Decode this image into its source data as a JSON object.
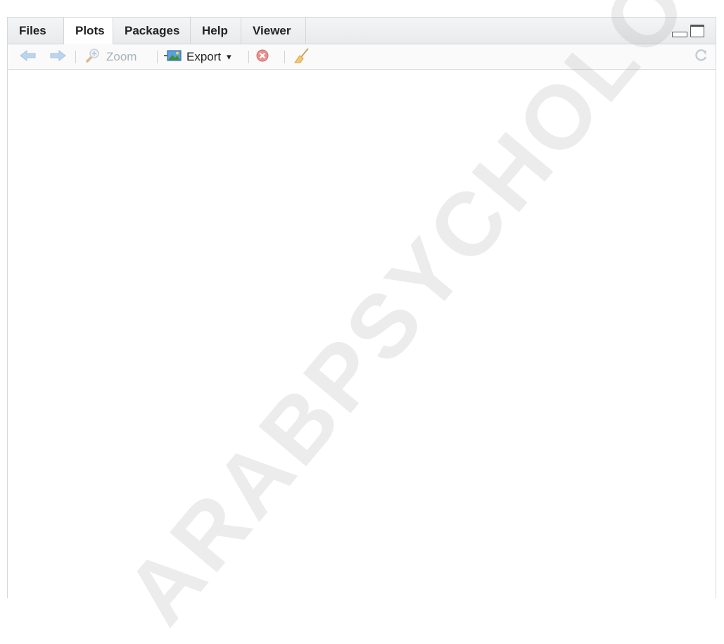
{
  "tabs": [
    {
      "label": "Files",
      "active": false
    },
    {
      "label": "Plots",
      "active": true
    },
    {
      "label": "Packages",
      "active": false
    },
    {
      "label": "Help",
      "active": false
    },
    {
      "label": "Viewer",
      "active": false
    }
  ],
  "toolbar": {
    "back_icon": "arrow-left-icon",
    "forward_icon": "arrow-right-icon",
    "zoom_icon": "magnifier-plus-icon",
    "zoom_label": "Zoom",
    "export_icon": "export-image-icon",
    "export_label": "Export",
    "export_caret": "▾",
    "remove_icon": "remove-plot-icon",
    "clear_icon": "broom-icon",
    "refresh_icon": "refresh-icon"
  },
  "watermark": {
    "text": "ARABPSYCHOLOGY."
  },
  "colors": {
    "disabled_icon": "#b9d2ea",
    "remove_red": "#e05a5a",
    "broom": "#e8b04a"
  }
}
